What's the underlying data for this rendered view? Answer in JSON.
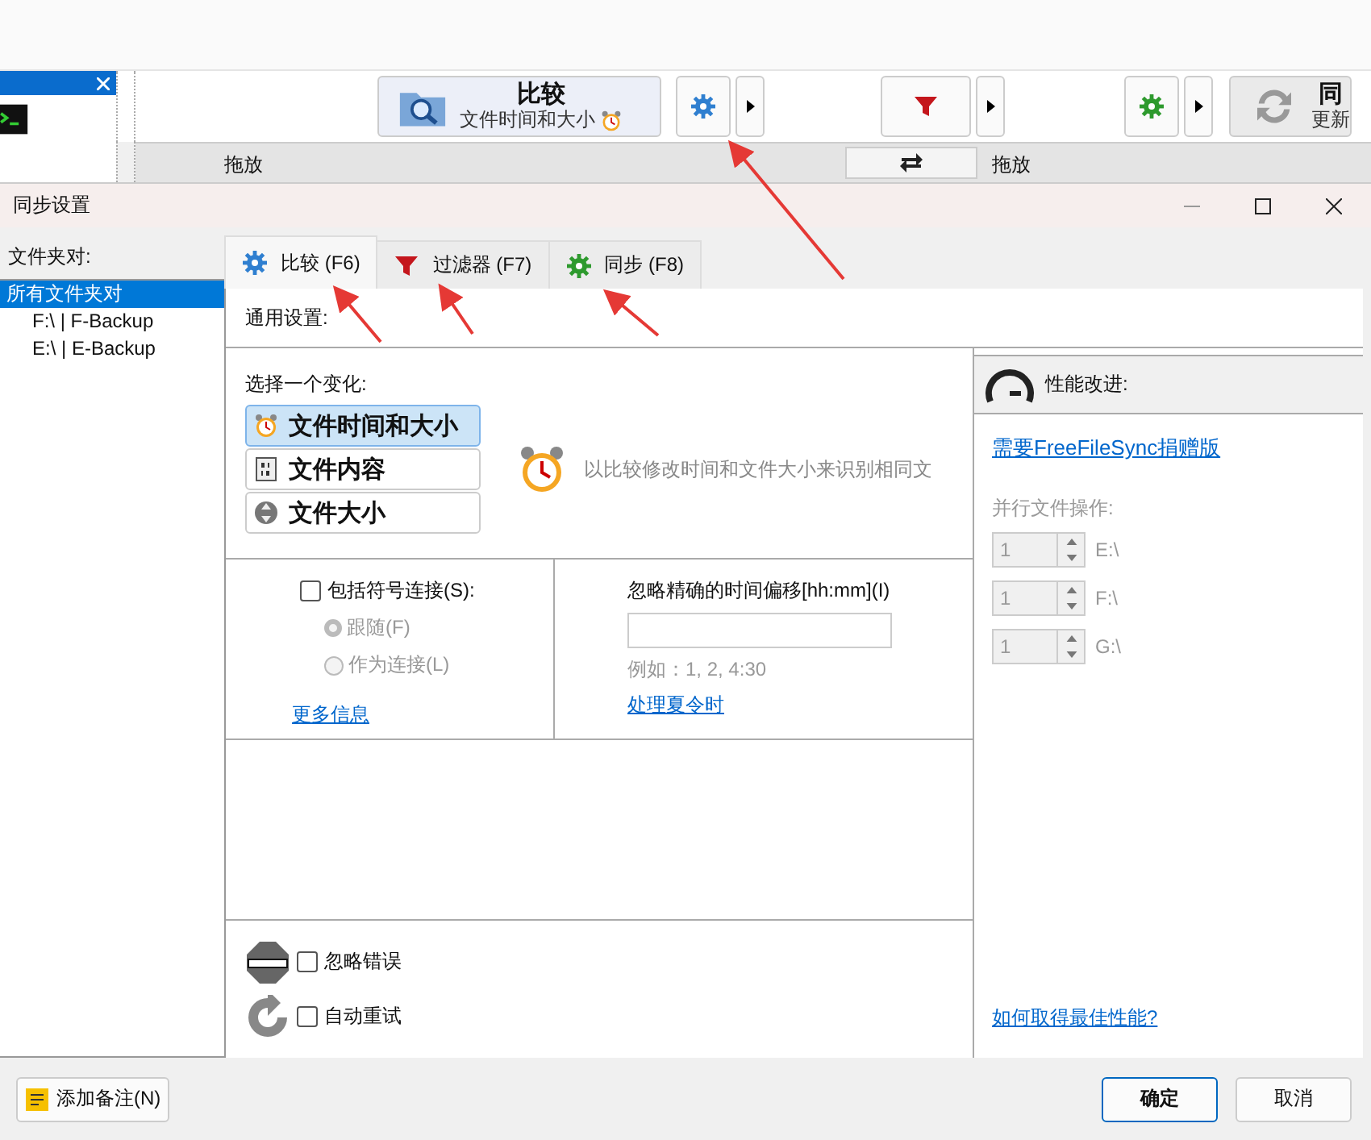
{
  "background_app": {
    "compare_button": {
      "title": "比较",
      "subtitle": "文件时间和大小"
    },
    "sync_button": {
      "title": "同",
      "subtitle": "更新"
    },
    "header_labels": [
      "拖放",
      "拖放"
    ]
  },
  "dialog": {
    "title": "同步设置"
  },
  "folder_pairs": {
    "label": "文件夹对:",
    "items": [
      {
        "label": "所有文件夹对",
        "selected": true,
        "children": [
          {
            "label": "F:\\ | F-Backup",
            "selected": false
          },
          {
            "label": "E:\\ | E-Backup",
            "selected": false
          }
        ]
      }
    ]
  },
  "tabs": [
    {
      "label": "比较 (F6)",
      "kind": "compare",
      "selected": true
    },
    {
      "label": "过滤器 (F7)",
      "kind": "filter",
      "selected": false
    },
    {
      "label": "同步 (F8)",
      "kind": "sync",
      "selected": false
    }
  ],
  "general_settings": {
    "heading": "通用设置:"
  },
  "variant": {
    "label": "选择一个变化:",
    "options": [
      {
        "label": "文件时间和大小",
        "kind": "time",
        "selected": true
      },
      {
        "label": "文件内容",
        "kind": "content",
        "selected": false
      },
      {
        "label": "文件大小",
        "kind": "size",
        "selected": false
      }
    ],
    "description": "以比较修改时间和文件大小来识别相同文"
  },
  "symlinks": {
    "label": "包括符号连接(S):",
    "checked": false,
    "disabled": true,
    "options": [
      {
        "label": "跟随(F)",
        "selected": true
      },
      {
        "label": "作为连接(L)",
        "selected": false
      }
    ],
    "more_info_link": "更多信息"
  },
  "time_shift": {
    "label": "忽略精确的时间偏移[hh:mm](I)",
    "example": "例如：1, 2, 4:30",
    "link": "处理夏令时"
  },
  "error_handling": [
    {
      "kind": "ignore",
      "label": "忽略错误",
      "checked": false
    },
    {
      "kind": "retry",
      "label": "自动重试",
      "checked": false
    }
  ],
  "performance": {
    "heading": "性能改进:",
    "donation_link": "需要FreeFileSync捐赠版",
    "parallel_label": "并行文件操作:",
    "disabled": true,
    "devices": [
      {
        "value": "1",
        "drive": "E:\\"
      },
      {
        "value": "1",
        "drive": "F:\\"
      },
      {
        "value": "1",
        "drive": "G:\\"
      }
    ],
    "help_link": "如何取得最佳性能?"
  },
  "footer": {
    "add_note_button": "添加备注(N)",
    "ok_button": "确定",
    "cancel_button": "取消"
  }
}
